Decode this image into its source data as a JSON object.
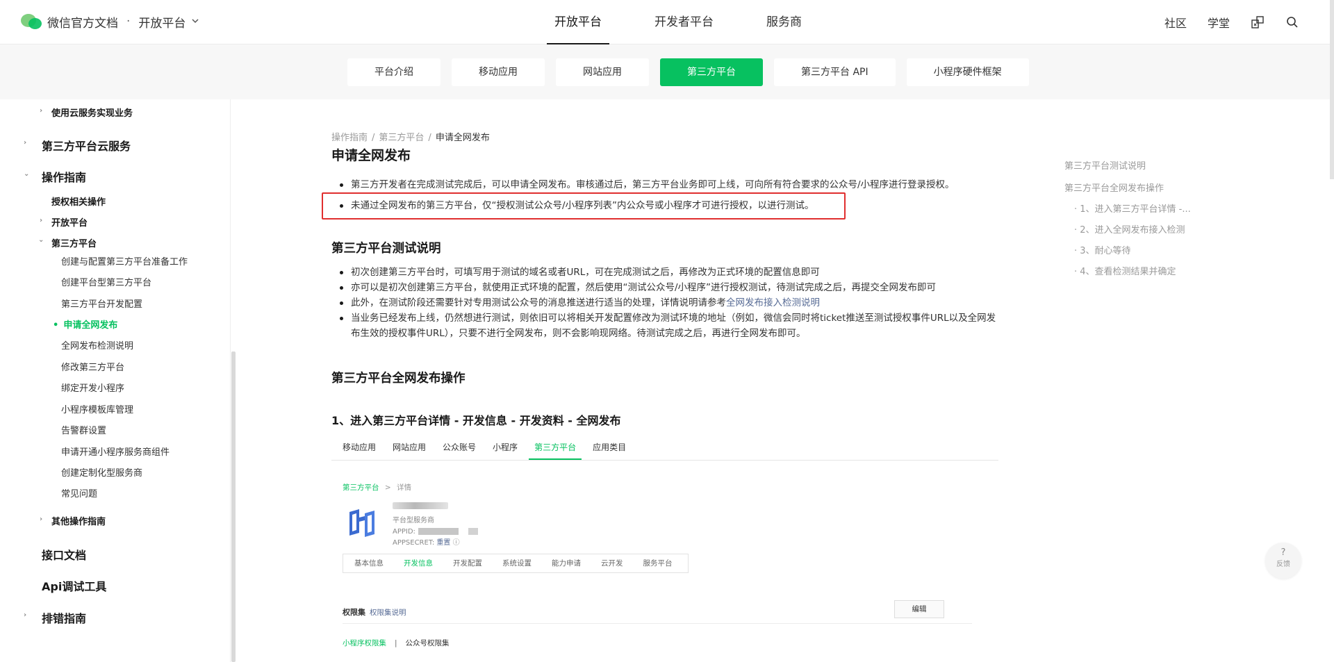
{
  "header": {
    "site_title": "微信官方文档",
    "dot": "·",
    "platform": "开放平台",
    "nav": [
      "开放平台",
      "开发者平台",
      "服务商"
    ],
    "right": {
      "community": "社区",
      "school": "学堂"
    }
  },
  "subnav": {
    "tabs": [
      "平台介绍",
      "移动应用",
      "网站应用",
      "第三方平台",
      "第三方平台 API",
      "小程序硬件框架"
    ]
  },
  "sidebar": {
    "top_cut": "使用云服务实现业务",
    "cloud": "第三方平台云服务",
    "ops": "操作指南",
    "auth": "授权相关操作",
    "open": "开放平台",
    "third": "第三方平台",
    "leaves": [
      "创建与配置第三方平台准备工作",
      "创建平台型第三方平台",
      "第三方平台开发配置",
      "申请全网发布",
      "全网发布检测说明",
      "修改第三方平台",
      "绑定开发小程序",
      "小程序模板库管理",
      "告警群设置",
      "申请开通小程序服务商组件",
      "创建定制化型服务商",
      "常见问题"
    ],
    "other_ops": "其他操作指南",
    "api_docs": "接口文档",
    "api_debug": "Api调试工具",
    "trouble": "排错指南"
  },
  "main": {
    "breadcrumb": [
      "操作指南",
      "第三方平台",
      "申请全网发布"
    ],
    "title": "申请全网发布",
    "intro": [
      "第三方开发者在完成测试完成后，可以申请全网发布。审核通过后，第三方平台业务即可上线，可向所有符合要求的公众号/小程序进行登录授权。",
      "未通过全网发布的第三方平台，仅“授权测试公众号/小程序列表”内公众号或小程序才可进行授权，以进行测试。"
    ],
    "test_title": "第三方平台测试说明",
    "test_items": [
      "初次创建第三方平台时，可填写用于测试的域名或者URL，可在完成测试之后，再修改为正式环境的配置信息即可",
      "亦可以是初次创建第三方平台，就使用正式环境的配置，然后使用“测试公众号/小程序”进行授权测试，待测试完成之后，再提交全网发布即可",
      "此外，在测试阶段还需要针对专用测试公众号的消息推送进行适当的处理，详情说明请参考",
      "当业务已经发布上线，仍然想进行测试，则依旧可以将相关开发配置修改为测试环境的地址（例如，微信会同时将ticket推送至测试授权事件URL以及全网发布生效的授权事件URL），只要不进行全网发布，则不会影响现网络。待测试完成之后，再进行全网发布即可。"
    ],
    "test_link": "全网发布接入检测说明",
    "publish_title": "第三方平台全网发布操作",
    "step1_title": "1、进入第三方平台详情 - 开发信息 - 开发资料 - 全网发布"
  },
  "embed": {
    "tabs": [
      "移动应用",
      "网站应用",
      "公众账号",
      "小程序",
      "第三方平台",
      "应用类目"
    ],
    "crumb_a": "第三方平台",
    "crumb_sep": ">",
    "crumb_b": "详情",
    "type": "平台型服务商",
    "appid": "APPID:",
    "appsecret": "APPSECRET:",
    "reset": "重置",
    "subtabs": [
      "基本信息",
      "开发信息",
      "开发配置",
      "系统设置",
      "能力申请",
      "云开发",
      "服务平台"
    ],
    "perm": "权限集",
    "perm_link": "权限集说明",
    "edit": "编辑",
    "perm_mini": "小程序权限集",
    "perm_sep": "|",
    "perm_mp": "公众号权限集"
  },
  "toc": {
    "items": [
      "第三方平台测试说明",
      "第三方平台全网发布操作",
      "· 1、进入第三方平台详情 -...",
      "· 2、进入全网发布接入检测",
      "· 3、耐心等待",
      "· 4、查看检测结果并确定"
    ]
  },
  "feedback": {
    "q": "?",
    "label": "反馈"
  },
  "colors": {
    "accent": "#07c160",
    "link": "#576b95",
    "highlight": "#e02e2e"
  }
}
